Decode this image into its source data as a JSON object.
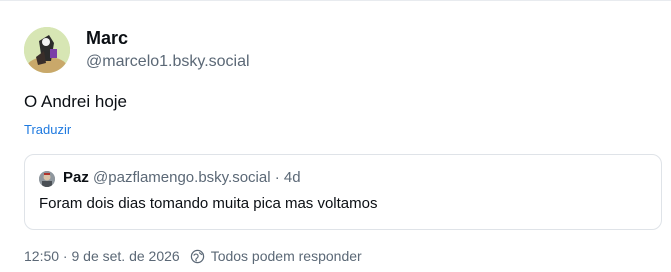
{
  "post": {
    "author_name": "Marc",
    "author_handle": "@marcelo1.bsky.social",
    "text": "O Andrei hoje",
    "translate_label": "Traduzir",
    "timestamp": "12:50 · 9 de set. de 2026",
    "reply_setting": "Todos podem responder"
  },
  "quote": {
    "author_name": "Paz",
    "author_handle": "@pazflamengo.bsky.social",
    "separator": "·",
    "age": "4d",
    "text": "Foram dois dias tomando muita pica mas voltamos"
  },
  "colors": {
    "link": "#1f7ae0",
    "muted": "#5b6876",
    "text": "#0b0f14"
  }
}
